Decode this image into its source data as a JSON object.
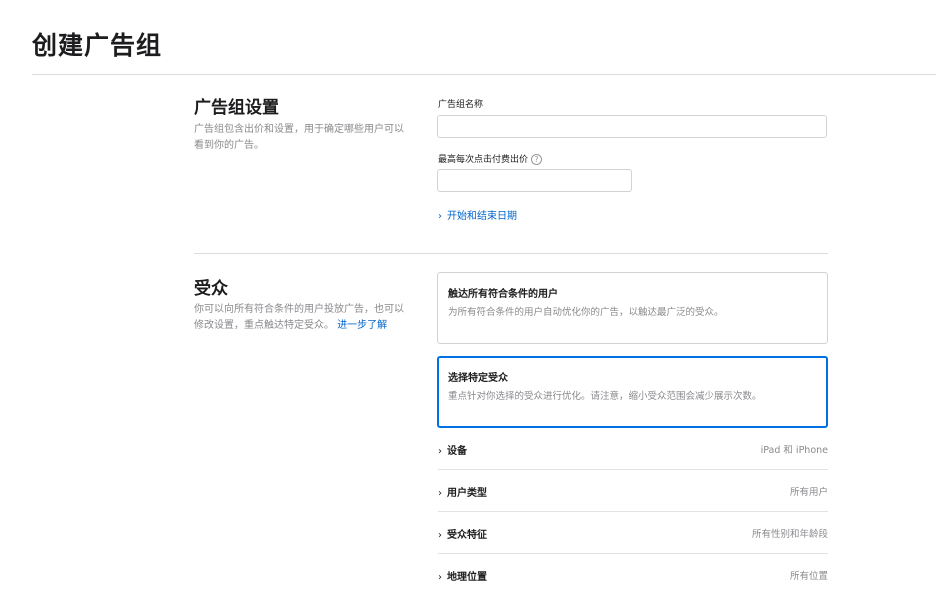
{
  "page_title": "创建广告组",
  "settings_section": {
    "title": "广告组设置",
    "description": "广告组包含出价和设置，用于确定哪些用户可以看到你的广告。",
    "name_field_label": "广告组名称",
    "name_field_value": "",
    "max_cpt_label": "最高每次点击付费出价",
    "max_cpt_value": "",
    "help_icon": "?",
    "dates_link": "开始和结束日期"
  },
  "audience_section": {
    "title": "受众",
    "description": "你可以向所有符合条件的用户投放广告，也可以修改设置，重点触达特定受众。",
    "learn_more": "进一步了解",
    "options": [
      {
        "title": "触达所有符合条件的用户",
        "desc": "为所有符合条件的用户自动优化你的广告，以触达最广泛的受众。",
        "selected": false
      },
      {
        "title": "选择特定受众",
        "desc": "重点针对你选择的受众进行优化。请注意，缩小受众范围会减少展示次数。",
        "selected": true
      }
    ],
    "rows": [
      {
        "label": "设备",
        "value": "iPad 和 iPhone"
      },
      {
        "label": "用户类型",
        "value": "所有用户"
      },
      {
        "label": "受众特征",
        "value": "所有性别和年龄段"
      },
      {
        "label": "地理位置",
        "value": "所有位置"
      }
    ]
  },
  "colors": {
    "accent": "#0071e3",
    "link": "#0066cc",
    "muted": "#8a8a8e"
  },
  "icons": {
    "chevron": "chevron-right-icon",
    "help": "help-circle-icon"
  }
}
